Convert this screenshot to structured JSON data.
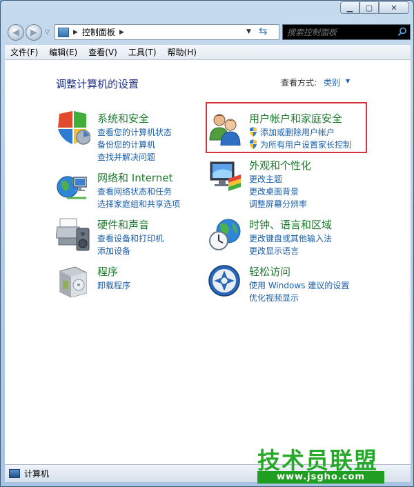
{
  "window": {
    "title_ghost": "",
    "address_path": "控制面板",
    "search_placeholder": "搜索控制面板",
    "status_text": "计算机"
  },
  "menu": [
    "文件(F)",
    "编辑(E)",
    "查看(V)",
    "工具(T)",
    "帮助(H)"
  ],
  "content": {
    "heading": "调整计算机的设置",
    "view_by_label": "查看方式:",
    "view_by_value": "类别"
  },
  "categories": {
    "system_security": {
      "title": "系统和安全",
      "links": [
        "查看您的计算机状态",
        "备份您的计算机",
        "查找并解决问题"
      ]
    },
    "network": {
      "title": "网络和 Internet",
      "links": [
        "查看网络状态和任务",
        "选择家庭组和共享选项"
      ]
    },
    "hardware": {
      "title": "硬件和声音",
      "links": [
        "查看设备和打印机",
        "添加设备"
      ]
    },
    "programs": {
      "title": "程序",
      "links": [
        "卸载程序"
      ]
    },
    "user_accounts": {
      "title": "用户帐户和家庭安全",
      "links": [
        "添加或删除用户帐户",
        "为所有用户设置家长控制"
      ]
    },
    "appearance": {
      "title": "外观和个性化",
      "links": [
        "更改主题",
        "更改桌面背景",
        "调整屏幕分辨率"
      ]
    },
    "clock_region": {
      "title": "时钟、语言和区域",
      "links": [
        "更改键盘或其他输入法",
        "更改显示语言"
      ]
    },
    "ease_access": {
      "title": "轻松访问",
      "links": [
        "使用 Windows 建议的设置",
        "优化视频显示"
      ]
    }
  },
  "watermark": {
    "title": "技术员联盟",
    "url": "www.jsgho.com"
  },
  "colors": {
    "link": "#1a5faa",
    "category_title": "#1c7a2d",
    "heading": "#1e3287",
    "highlight_border": "#d6303a",
    "watermark_green": "#26a928"
  }
}
